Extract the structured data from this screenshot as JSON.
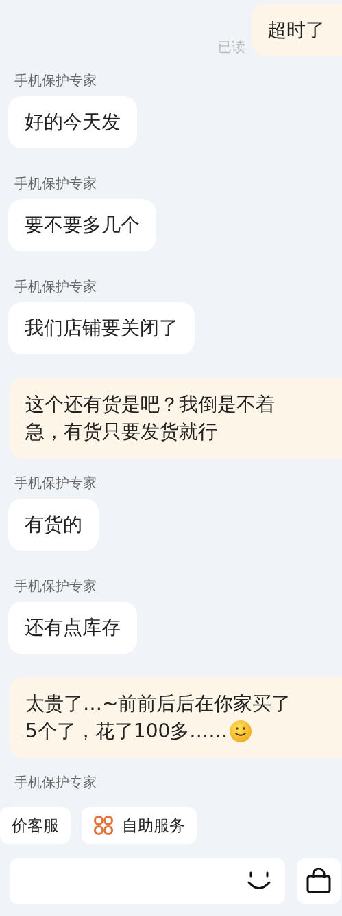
{
  "messages": [
    {
      "kind": "sent",
      "text": "超时了",
      "status": "已读",
      "emoji": false
    },
    {
      "kind": "received",
      "sender": "手机保护专家",
      "text": "好的今天发"
    },
    {
      "kind": "received",
      "sender": "手机保护专家",
      "text": "要不要多几个"
    },
    {
      "kind": "received",
      "sender": "手机保护专家",
      "text": "我们店铺要关闭了"
    },
    {
      "kind": "sent",
      "text": "这个还有货是吧？我倒是不着急，有货只要发货就行",
      "emoji": false
    },
    {
      "kind": "received",
      "sender": "手机保护专家",
      "text": "有货的"
    },
    {
      "kind": "received",
      "sender": "手机保护专家",
      "text": "还有点库存"
    },
    {
      "kind": "sent",
      "text": "太贵了…~前前后后在你家买了5个了，花了100多……",
      "emoji": true
    },
    {
      "kind": "sender_only",
      "sender": "手机保护专家"
    }
  ],
  "quick_actions": [
    {
      "label": "价客服",
      "icon": false
    },
    {
      "label": "自助服务",
      "icon": true
    }
  ]
}
